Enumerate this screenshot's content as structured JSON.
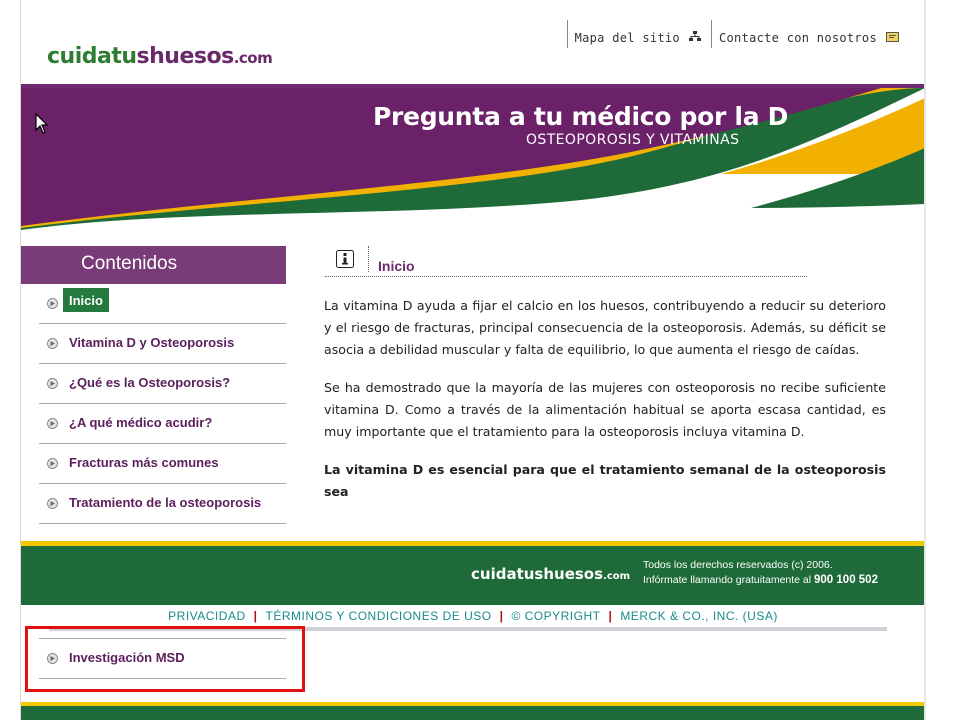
{
  "header": {
    "logo": {
      "part1": "cuidatu",
      "part2": "shuesos",
      "part3": ".com"
    },
    "links": [
      {
        "label": "Mapa del sitio",
        "icon": "sitemap-icon"
      },
      {
        "label": "Contacte con nosotros",
        "icon": "mail-icon"
      }
    ]
  },
  "banner": {
    "title": "Pregunta a tu médico por la D",
    "subtitle": "OSTEOPOROSIS Y VITAMINAS",
    "colors": {
      "purple": "#6a2168",
      "yellow": "#f2b100",
      "green": "#1e6a38"
    }
  },
  "sidebar": {
    "heading": "Contenidos",
    "items": [
      {
        "label": "Inicio",
        "active": true
      },
      {
        "label": "Vitamina D y Osteoporosis"
      },
      {
        "label": "¿Qué es la Osteoporosis?"
      },
      {
        "label": "¿A qué médico acudir?"
      },
      {
        "label": "Fracturas más comunes"
      },
      {
        "label": "Tratamiento de la osteoporosis"
      }
    ],
    "highlighted_item": {
      "label": "Investigación MSD"
    }
  },
  "content": {
    "title": "Inicio",
    "paragraphs": [
      "La vitamina D ayuda a fijar el calcio en los huesos, contribuyendo a reducir su deterioro y el riesgo de fracturas, principal consecuencia de la osteoporosis. Además, su déficit se asocia a debilidad muscular y falta de equilibrio, lo que aumenta el riesgo de caídas.",
      "Se ha demostrado que la mayoría de las mujeres con osteoporosis no recibe suficiente vitamina D. Como a través de la alimentación habitual se aporta escasa cantidad, es muy importante que el tratamiento para la osteoporosis incluya vitamina D.",
      "La vitamina D es esencial para que el tratamiento semanal de la osteoporosis sea"
    ]
  },
  "footer": {
    "logo_main": "cuidatushuesos",
    "logo_suffix": ".com",
    "copyright": "Todos los derechos reservados (c) 2006.",
    "phone_text": "Infórmate llamando gratuitamente al",
    "phone": "900 100 502",
    "links": [
      "PRIVACIDAD",
      "TÉRMINOS Y CONDICIONES DE USO",
      "© COPYRIGHT",
      "MERCK & CO., INC. (USA)"
    ],
    "separator": "|"
  }
}
